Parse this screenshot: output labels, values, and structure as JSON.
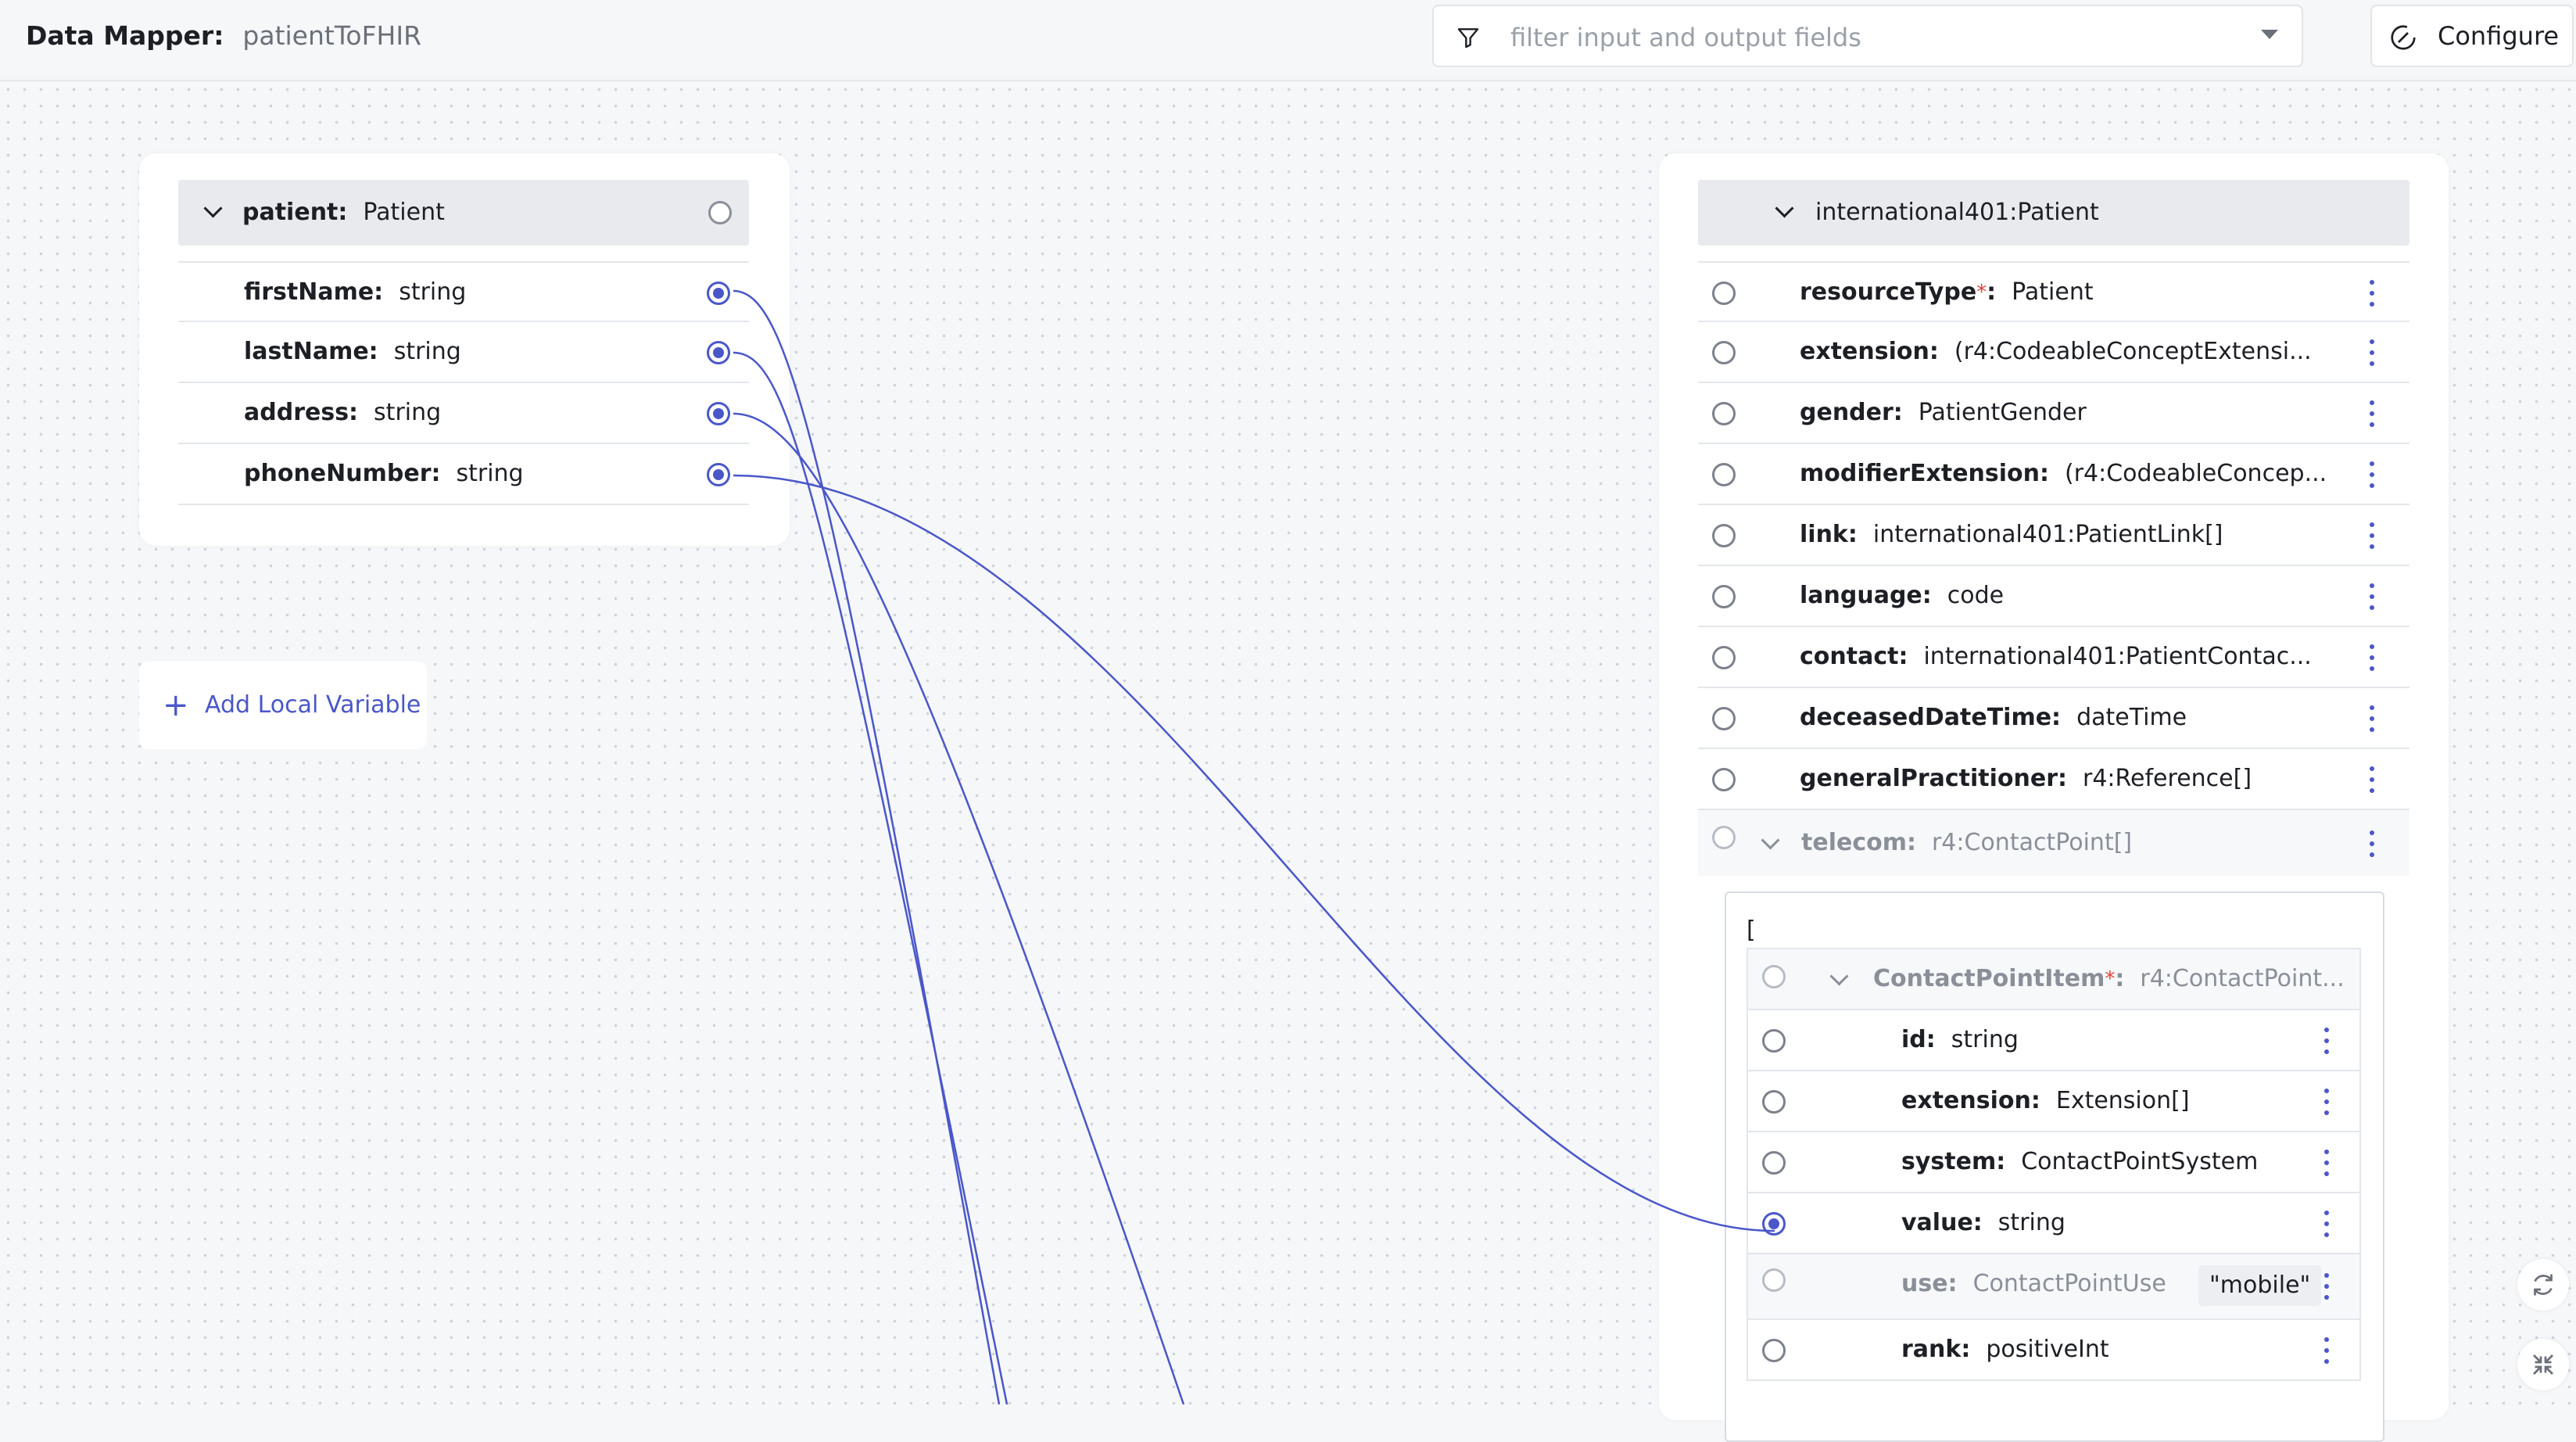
{
  "header": {
    "title_label": "Data Mapper:",
    "title_value": "patientToFHIR",
    "filter_placeholder": "filter input and output fields",
    "configure_label": "Configure"
  },
  "input": {
    "header_name": "patient:",
    "header_type": "Patient",
    "fields": [
      {
        "name": "firstName:",
        "type": "string"
      },
      {
        "name": "lastName:",
        "type": "string"
      },
      {
        "name": "address:",
        "type": "string"
      },
      {
        "name": "phoneNumber:",
        "type": "string"
      }
    ]
  },
  "add_local_variable": "Add Local Variable",
  "output": {
    "header": "international401:Patient",
    "fields": [
      {
        "name": "resourceType",
        "required": "*",
        "colon": ":",
        "type": "Patient"
      },
      {
        "name": "extension:",
        "type": "(r4:CodeableConceptExtensi..."
      },
      {
        "name": "gender:",
        "type": "PatientGender"
      },
      {
        "name": "modifierExtension:",
        "type": "(r4:CodeableConcep..."
      },
      {
        "name": "link:",
        "type": "international401:PatientLink[]"
      },
      {
        "name": "language:",
        "type": "code"
      },
      {
        "name": "contact:",
        "type": "international401:PatientContac..."
      },
      {
        "name": "deceasedDateTime:",
        "type": "dateTime"
      },
      {
        "name": "generalPractitioner:",
        "type": "r4:Reference[]"
      }
    ],
    "telecom": {
      "name": "telecom:",
      "type": "r4:ContactPoint[]",
      "bracket": "[",
      "item_name": "ContactPointItem",
      "item_required": "*",
      "item_colon": ":",
      "item_type": "r4:ContactPoint...",
      "subfields": [
        {
          "name": "id:",
          "type": "string"
        },
        {
          "name": "extension:",
          "type": "Extension[]"
        },
        {
          "name": "system:",
          "type": "ContactPointSystem"
        },
        {
          "name": "value:",
          "type": "string"
        },
        {
          "name": "use:",
          "type": "ContactPointUse",
          "value": "\"mobile\""
        },
        {
          "name": "rank:",
          "type": "positiveInt"
        }
      ]
    }
  },
  "colors": {
    "accent": "#4a57c9",
    "required": "#e53e3e"
  }
}
